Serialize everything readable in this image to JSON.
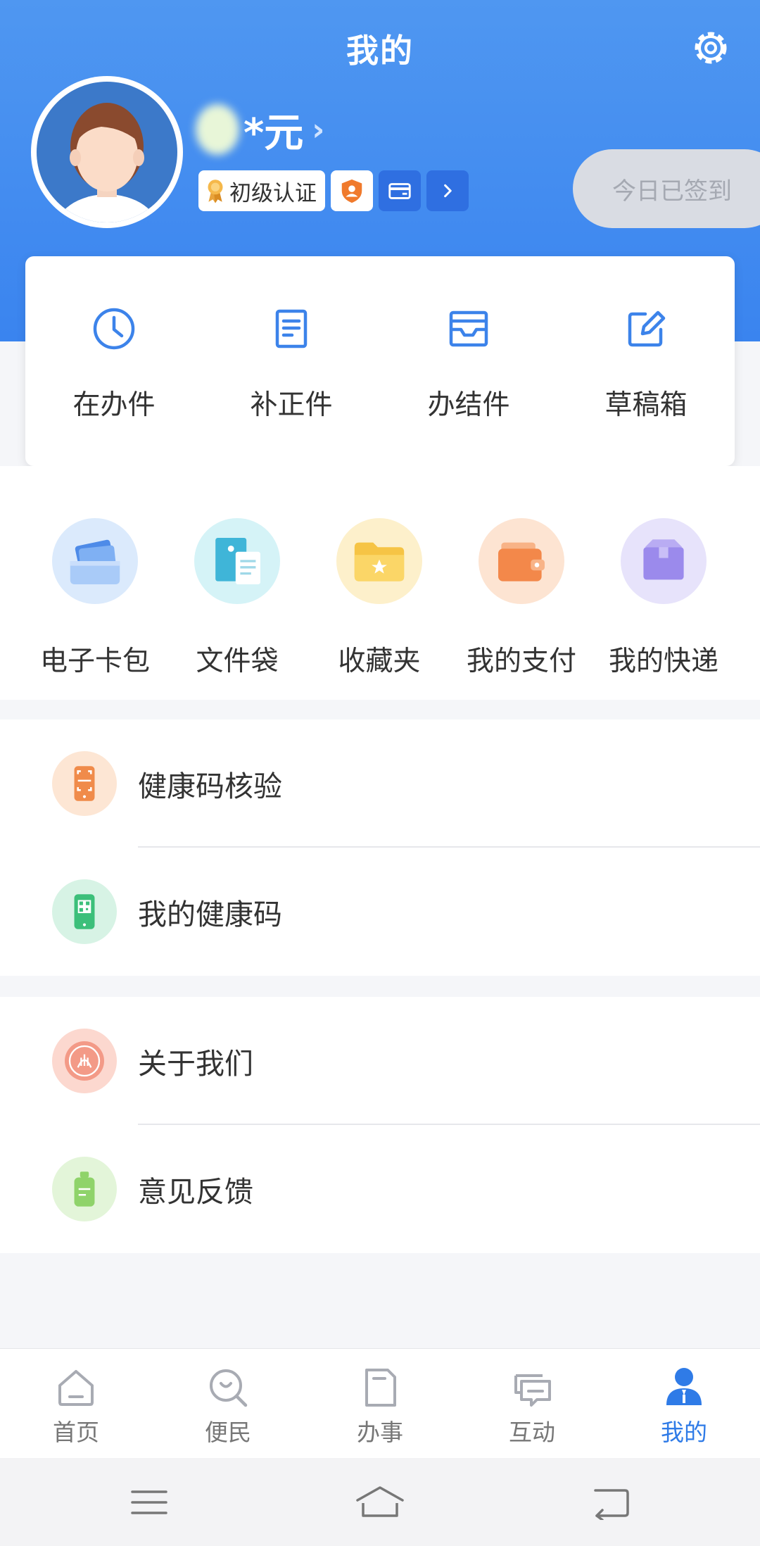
{
  "header": {
    "title": "我的",
    "settings_icon": "gear-icon",
    "background_color": "#4a90f0"
  },
  "profile": {
    "name_visible": "*元",
    "verification_badge": "初级认证",
    "checkin_label": "今日已签到"
  },
  "service_card": {
    "items": [
      {
        "label": "在办件",
        "icon": "clock-icon"
      },
      {
        "label": "补正件",
        "icon": "document-icon"
      },
      {
        "label": "办结件",
        "icon": "inbox-icon"
      },
      {
        "label": "草稿箱",
        "icon": "edit-icon"
      }
    ]
  },
  "quick_entries": [
    {
      "label": "电子卡包",
      "icon": "card-wallet-icon"
    },
    {
      "label": "文件袋",
      "icon": "file-bag-icon"
    },
    {
      "label": "收藏夹",
      "icon": "favorites-folder-icon"
    },
    {
      "label": "我的支付",
      "icon": "wallet-icon"
    },
    {
      "label": "我的快递",
      "icon": "package-icon"
    }
  ],
  "health_group": [
    {
      "label": "健康码核验",
      "icon": "scan-phone-icon"
    },
    {
      "label": "我的健康码",
      "icon": "qr-phone-icon"
    }
  ],
  "about_group": [
    {
      "label": "关于我们",
      "icon": "emblem-icon"
    },
    {
      "label": "意见反馈",
      "icon": "feedback-bottle-icon"
    }
  ],
  "tabbar": {
    "items": [
      {
        "label": "首页",
        "icon": "home-icon"
      },
      {
        "label": "便民",
        "icon": "search-heart-icon"
      },
      {
        "label": "办事",
        "icon": "document-icon"
      },
      {
        "label": "互动",
        "icon": "chat-icon"
      },
      {
        "label": "我的",
        "icon": "person-icon"
      }
    ],
    "active_index": 4,
    "active_color": "#2f7be7"
  }
}
